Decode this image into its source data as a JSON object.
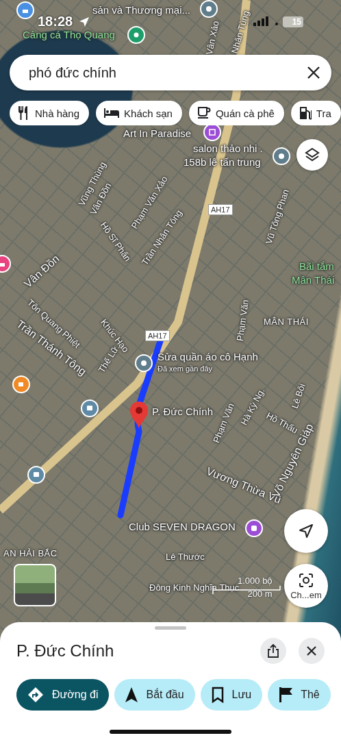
{
  "status_bar": {
    "time": "18:28",
    "battery": "15"
  },
  "search": {
    "value": "phó đức chính"
  },
  "chips": [
    {
      "label": "Nhà hàng",
      "kind": "restaurant"
    },
    {
      "label": "Khách sạn",
      "kind": "hotel"
    },
    {
      "label": "Quán cà phê",
      "kind": "cafe"
    },
    {
      "label": "Tra",
      "kind": "gas"
    }
  ],
  "map_labels": [
    {
      "text": "sản và Thương mại...",
      "kind": "poi"
    },
    {
      "text": "Cảng cá Thọ Quang",
      "kind": "place"
    },
    {
      "text": "Vân Xảo",
      "kind": "street"
    },
    {
      "text": "Nhân Tùng",
      "kind": "street"
    },
    {
      "text": "Art In Paradise",
      "kind": "poi"
    },
    {
      "text": "salon thảo nhi .",
      "kind": "poi"
    },
    {
      "text": "158b lê tấn trung",
      "kind": "poi"
    },
    {
      "text": "Vũng Thùng",
      "kind": "street"
    },
    {
      "text": "Vân Đồn",
      "kind": "street"
    },
    {
      "text": "Phạm Văn Xảo",
      "kind": "street"
    },
    {
      "text": "Hồ Sĩ Phấn",
      "kind": "street"
    },
    {
      "text": "Trần Nhân Tông",
      "kind": "street"
    },
    {
      "text": "AH17",
      "kind": "shield"
    },
    {
      "text": "Vũ Tông Phan",
      "kind": "street"
    },
    {
      "text": "Bãi tắm",
      "kind": "place"
    },
    {
      "text": "Mân Thái",
      "kind": "place"
    },
    {
      "text": "Vân Đồn",
      "kind": "major"
    },
    {
      "text": "Tôn Quang Phiệt",
      "kind": "street"
    },
    {
      "text": "Trần Thánh Tông",
      "kind": "major"
    },
    {
      "text": "Khúc Hạo",
      "kind": "street"
    },
    {
      "text": "Phạm Văn",
      "kind": "street"
    },
    {
      "text": "MÂN THÁI",
      "kind": "area"
    },
    {
      "text": "AH17",
      "kind": "shield"
    },
    {
      "text": "Thế Lữ",
      "kind": "street"
    },
    {
      "text": "Sửa quần áo cô Hạnh",
      "kind": "poi"
    },
    {
      "text": "Đã xem gần đây",
      "kind": "note"
    },
    {
      "text": "P. Đức Chính",
      "kind": "poi"
    },
    {
      "text": "Phạm Văn",
      "kind": "street"
    },
    {
      "text": "Hà Kỳ Ng.",
      "kind": "street"
    },
    {
      "text": "Hồ Thấu",
      "kind": "street"
    },
    {
      "text": "Lê Bôi",
      "kind": "street"
    },
    {
      "text": "Vương Thừa Vũ",
      "kind": "major"
    },
    {
      "text": "Võ Nguyên Giáp",
      "kind": "major"
    },
    {
      "text": "Club SEVEN DRAGON",
      "kind": "poi"
    },
    {
      "text": "Lê Thước",
      "kind": "street"
    },
    {
      "text": "Đông Kinh Nghĩa Thục",
      "kind": "street"
    },
    {
      "text": "AN HẢI BẮC",
      "kind": "area"
    }
  ],
  "pins": [
    {
      "kind": "shop",
      "color": "#4a90e2"
    },
    {
      "kind": "pin",
      "color": "#607d8b"
    },
    {
      "kind": "park",
      "color": "#1e9e6a"
    },
    {
      "kind": "museum",
      "color": "#9c4dd6"
    },
    {
      "kind": "pin",
      "color": "#607d8b"
    },
    {
      "kind": "pin",
      "color": "#607d8b"
    },
    {
      "kind": "shop",
      "color": "#e8437e"
    },
    {
      "kind": "cafe",
      "color": "#f08a24"
    },
    {
      "kind": "bus",
      "color": "#5f8aa6"
    },
    {
      "kind": "bus",
      "color": "#5f8aa6"
    },
    {
      "kind": "club",
      "color": "#9c4dd6"
    },
    {
      "kind": "selected",
      "color": "#e53935"
    }
  ],
  "scale": {
    "imperial": "1.000 bộ",
    "metric": "200 m"
  },
  "lens_button": {
    "label": "Ch...em"
  },
  "sheet": {
    "title": "P. Đức Chính",
    "actions": [
      {
        "label": "Đường đi",
        "kind": "directions",
        "primary": true
      },
      {
        "label": "Bắt đầu",
        "kind": "start",
        "primary": false
      },
      {
        "label": "Lưu",
        "kind": "save",
        "primary": false
      },
      {
        "label": "Thê",
        "kind": "flag",
        "primary": false
      }
    ]
  }
}
